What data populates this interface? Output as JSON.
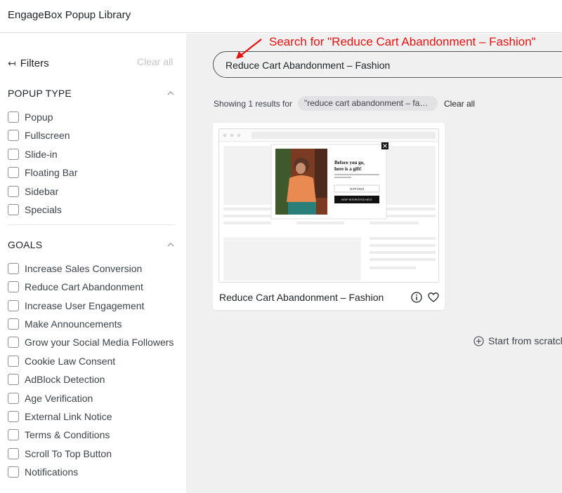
{
  "header": {
    "title": "EngageBox Popup Library"
  },
  "sidebar": {
    "filters_label": "Filters",
    "clear_all": "Clear all",
    "popup_type": {
      "title": "POPUP TYPE",
      "options": [
        "Popup",
        "Fullscreen",
        "Slide-in",
        "Floating Bar",
        "Sidebar",
        "Specials"
      ]
    },
    "goals": {
      "title": "GOALS",
      "options": [
        "Increase Sales Conversion",
        "Reduce Cart Abandonment",
        "Increase User Engagement",
        "Make Announcements",
        "Grow your Social Media Followers",
        "Cookie Law Consent",
        "AdBlock Detection",
        "Age Verification",
        "External Link Notice",
        "Terms & Conditions",
        "Scroll To Top Button",
        "Notifications"
      ]
    }
  },
  "search": {
    "value": "Reduce Cart Abandonment – Fashion"
  },
  "annotation": {
    "text": "Search for \"Reduce Cart Abandonment – Fashion\"",
    "color": "#e8110f"
  },
  "results": {
    "showing_text": "Showing 1 results for",
    "query_chip": "\"reduce cart abandonment – fashion\"",
    "clear_all": "Clear all"
  },
  "card": {
    "title": "Reduce Cart Abandonment – Fashion",
    "popup": {
      "heading": "Before you go, here is a gift!",
      "body": "Shop today and get 10% discount with the code below.",
      "code": "GIFT2023",
      "button": "KEEP INTERESTED NEXT"
    }
  },
  "start_from_scratch": "Start from scratch",
  "icons": [
    "arrow-left-bar-icon",
    "chevron-up-icon",
    "info-icon",
    "heart-icon",
    "plus-circle-icon"
  ]
}
